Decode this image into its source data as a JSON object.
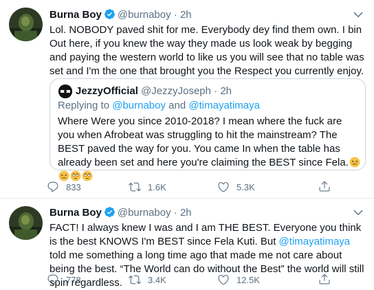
{
  "tweets": [
    {
      "author_name": "Burna Boy",
      "handle": "@burnaboy",
      "time": "· 2h",
      "text": "Lol. NOBODY paved shit for me. Everybody dey find them own. I bin Out here, if you knew the way they made us look weak by begging and paying the western world to like us you will see that no table was set and I'm the one that brought you the Respect you currently enjoy.",
      "quote": {
        "author_name": "JezzyOfficial",
        "handle": "@JezzyJoseph",
        "time": "· 2h",
        "replying_prefix": "Replying to ",
        "replying_mention_1": "@burnaboy",
        "replying_and": " and ",
        "replying_mention_2": "@timayatimaya",
        "text": "Where Were you since 2010-2018? I mean where the fuck are you when Afrobeat was struggling to hit the mainstream? The BEST paved the way for you. You came In when  the table has already been set and here you're claiming the  BEST since Fela.",
        "emojis": [
          "persevering-face",
          "persevering-face",
          "face-with-rolling-eyes",
          "face-with-rolling-eyes"
        ]
      },
      "replies": "833",
      "retweets": "1.6K",
      "likes": "5.3K"
    },
    {
      "author_name": "Burna Boy",
      "handle": "@burnaboy",
      "time": "· 2h",
      "text_part1": "FACT! I always knew I was and I am THE BEST. Everyone you think is the best KNOWS I'm BEST since Fela Kuti. But ",
      "mention": "@timayatimaya",
      "text_part2": " told me something a long time ago that made me not care about being the best. “The World can do without the Best” the world will still spin regardless.",
      "replies": "778",
      "retweets": "3.4K",
      "likes": "12.5K"
    }
  ],
  "colors": {
    "accent": "#1da1f2",
    "secondary_text": "#5b7083",
    "border": "#ccd6dd"
  },
  "icons": [
    "reply-icon",
    "retweet-icon",
    "like-icon",
    "share-icon",
    "verified-badge-icon",
    "caret-down-icon"
  ]
}
